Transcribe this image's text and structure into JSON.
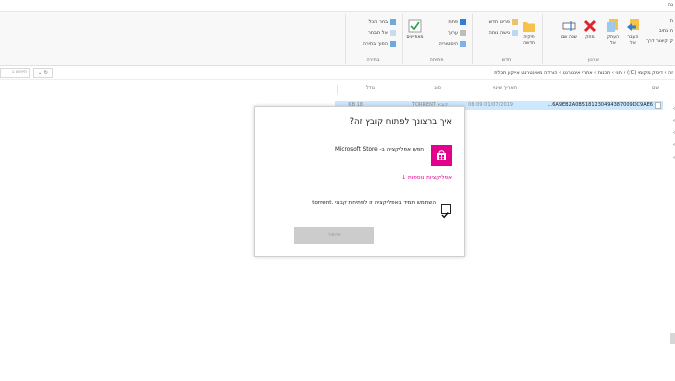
{
  "tabstrip": {
    "label": "גה"
  },
  "ribbon": {
    "groups": {
      "organize": {
        "label": "ארגון",
        "move_to": "העבר אל",
        "copy_to": "העתק אל",
        "delete": "מחק",
        "rename": "שנה שם"
      },
      "new": {
        "label": "חדש",
        "new_folder": "תיקיה חדשה",
        "new_item": "פריט חדש",
        "easy_access": "גישה נוחה"
      },
      "open": {
        "label": "פתיחה",
        "properties": "מאפיינים",
        "open": "פתח",
        "edit": "ערוך",
        "history": "היסטוריה"
      },
      "select": {
        "label": "בחירה",
        "select_all": "בחר הכל",
        "select_none": "אל תבחר",
        "invert_selection": "הפוך בחירה"
      }
    },
    "clipboard_fragments": [
      "ת",
      "ח נתיב",
      "ק קיצור דרך"
    ]
  },
  "address": {
    "path": "זה  ›  דיסק מקומי (C:)  ›  חני  ›  תכנות  ›  אתרי אינטרנט  ›  הורדה מאינטרנט אייקון תכלת",
    "search_placeholder": "חיפוש ב",
    "refresh": "↻ ⌄"
  },
  "columns": {
    "name": "שם",
    "date": "תאריך שינוי",
    "type": "סוג",
    "size": "גודל"
  },
  "file": {
    "name": "6A9EB2A0B5181230494387009DC9AE6...",
    "date": "01/07/2019 06:09",
    "type": "קובץ TORRENT",
    "size": "KB 18"
  },
  "dialog": {
    "title": "איך ברצונך לפתוח קובץ זה?",
    "store_option": "חפש אפליקציה ב- Microsoft Store",
    "more_apps": "אפליקציות נוספות ↓",
    "checkbox_label": "השתמש תמיד באפליקציה זו לפתיחת קבצי .torrent",
    "checkbox_checked": true,
    "ok": "אישור"
  },
  "colors": {
    "accent": "#e3008c",
    "selection": "#cce8ff"
  }
}
